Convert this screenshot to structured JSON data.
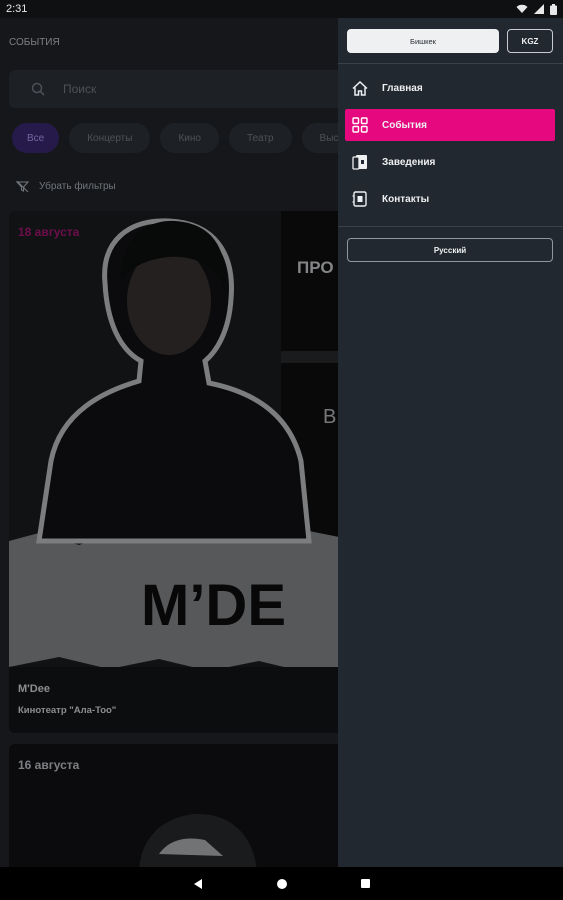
{
  "status_bar": {
    "time": "2:31",
    "icons": [
      "wifi-icon",
      "signal-icon",
      "battery-icon"
    ]
  },
  "header": {
    "title": "СОБЫТИЯ"
  },
  "search": {
    "placeholder": "Поиск"
  },
  "filters": {
    "chips": [
      "Все",
      "Концерты",
      "Кино",
      "Театр",
      "Выст"
    ],
    "active_index": 0,
    "clear_label": "Убрать фильтры"
  },
  "events": [
    {
      "date": "18 августа",
      "title": "M'Dee",
      "venue": "Кинотеатр \"Ала-Too\"",
      "poster_text_large": "M’DE",
      "poster_text_small": "ПРО",
      "poster_text_side": "В"
    },
    {
      "date": "16 августа"
    }
  ],
  "drawer": {
    "city_button": "Бишкек",
    "currency_button": "KGZ",
    "menu": [
      {
        "label": "Главная",
        "icon": "home-icon",
        "active": false
      },
      {
        "label": "События",
        "icon": "grid-icon",
        "active": true
      },
      {
        "label": "Заведения",
        "icon": "venue-icon",
        "active": false
      },
      {
        "label": "Контакты",
        "icon": "contacts-icon",
        "active": false
      }
    ],
    "language_button": "Русский"
  },
  "nav_bar": {
    "buttons": [
      "back-icon",
      "home-circle-icon",
      "recents-icon"
    ]
  },
  "colors": {
    "accent": "#e6087f",
    "date_accent": "#b1177a",
    "active_chip": "#3e2a7a",
    "drawer_bg": "#21282f"
  }
}
